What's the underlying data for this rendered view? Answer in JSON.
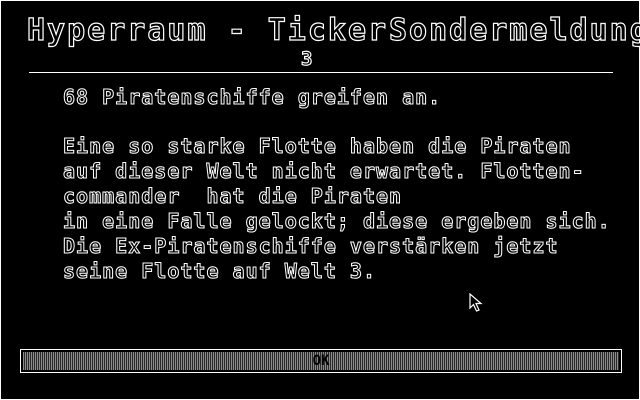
{
  "header": {
    "title": "Hyperraum - Ticker",
    "category": "Sondermeldung",
    "number": "3"
  },
  "message": {
    "headline": "68 Piratenschiffe greifen an.",
    "lines": [
      "Eine so starke Flotte haben die Piraten",
      "auf dieser Welt nicht erwartet. Flotten-",
      "commander  hat die Piraten",
      "in eine Falle gelockt; diese ergeben sich.",
      "Die Ex-Piratenschiffe verstärken jetzt",
      "seine Flotte auf Welt 3."
    ]
  },
  "ok_button": {
    "label": "OK"
  },
  "icons": {
    "cursor": "mouse-pointer-icon"
  }
}
